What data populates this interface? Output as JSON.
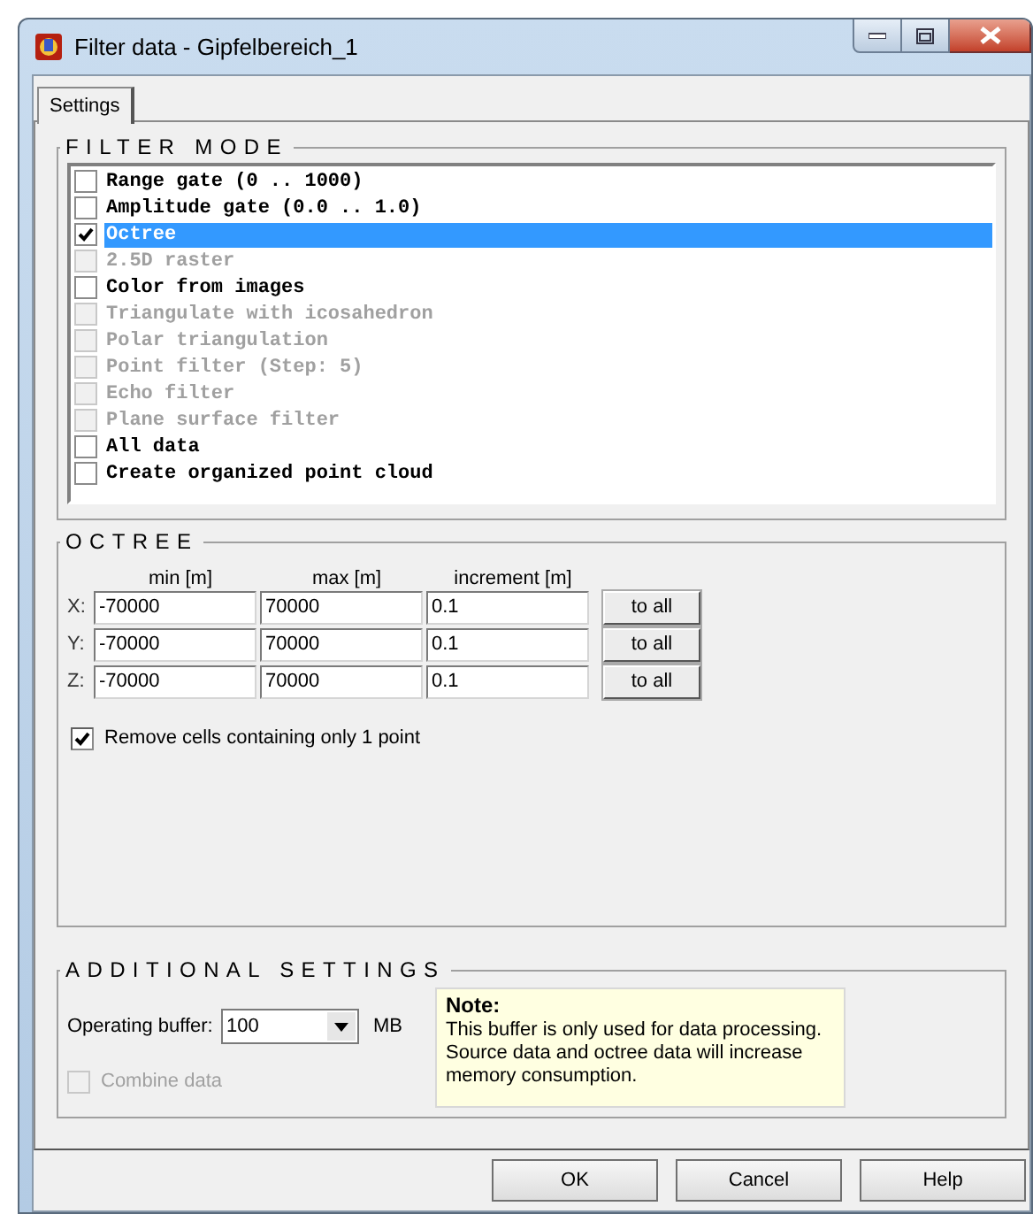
{
  "window": {
    "title": "Filter data - Gipfelbereich_1"
  },
  "tabs": [
    {
      "label": "Settings",
      "selected": true
    }
  ],
  "filter_mode": {
    "title": "FILTER MODE",
    "items": [
      {
        "label": "Range gate (0 .. 1000)",
        "checked": false,
        "disabled": false,
        "selected": false
      },
      {
        "label": "Amplitude gate (0.0 .. 1.0)",
        "checked": false,
        "disabled": false,
        "selected": false
      },
      {
        "label": "Octree",
        "checked": true,
        "disabled": false,
        "selected": true
      },
      {
        "label": "2.5D raster",
        "checked": false,
        "disabled": true,
        "selected": false
      },
      {
        "label": "Color from images",
        "checked": false,
        "disabled": false,
        "selected": false
      },
      {
        "label": "Triangulate with icosahedron",
        "checked": false,
        "disabled": true,
        "selected": false
      },
      {
        "label": "Polar triangulation",
        "checked": false,
        "disabled": true,
        "selected": false
      },
      {
        "label": "Point filter (Step: 5)",
        "checked": false,
        "disabled": true,
        "selected": false
      },
      {
        "label": "Echo filter",
        "checked": false,
        "disabled": true,
        "selected": false
      },
      {
        "label": "Plane surface filter",
        "checked": false,
        "disabled": true,
        "selected": false
      },
      {
        "label": "All data",
        "checked": false,
        "disabled": false,
        "selected": false
      },
      {
        "label": "Create organized point cloud",
        "checked": false,
        "disabled": false,
        "selected": false
      }
    ]
  },
  "octree": {
    "title": "OCTREE",
    "columns": [
      "min [m]",
      "max [m]",
      "increment [m]"
    ],
    "rows": [
      {
        "axis": "X:",
        "min": "-70000",
        "max": "70000",
        "increment": "0.1",
        "button": "to all"
      },
      {
        "axis": "Y:",
        "min": "-70000",
        "max": "70000",
        "increment": "0.1",
        "button": "to all"
      },
      {
        "axis": "Z:",
        "min": "-70000",
        "max": "70000",
        "increment": "0.1",
        "button": "to all"
      }
    ],
    "remove_cells": {
      "label": "Remove cells containing only 1 point",
      "checked": true,
      "disabled": false
    }
  },
  "additional_settings": {
    "title": "ADDITIONAL SETTINGS",
    "buffer_label": "Operating buffer:",
    "buffer_value": "100",
    "buffer_unit": "MB",
    "combine": {
      "label": "Combine data",
      "checked": false,
      "disabled": true
    },
    "note": {
      "title": "Note:",
      "text": "This buffer is only used for data processing. Source data and octree data will increase memory consumption."
    }
  },
  "buttons": [
    "OK",
    "Cancel",
    "Help"
  ]
}
